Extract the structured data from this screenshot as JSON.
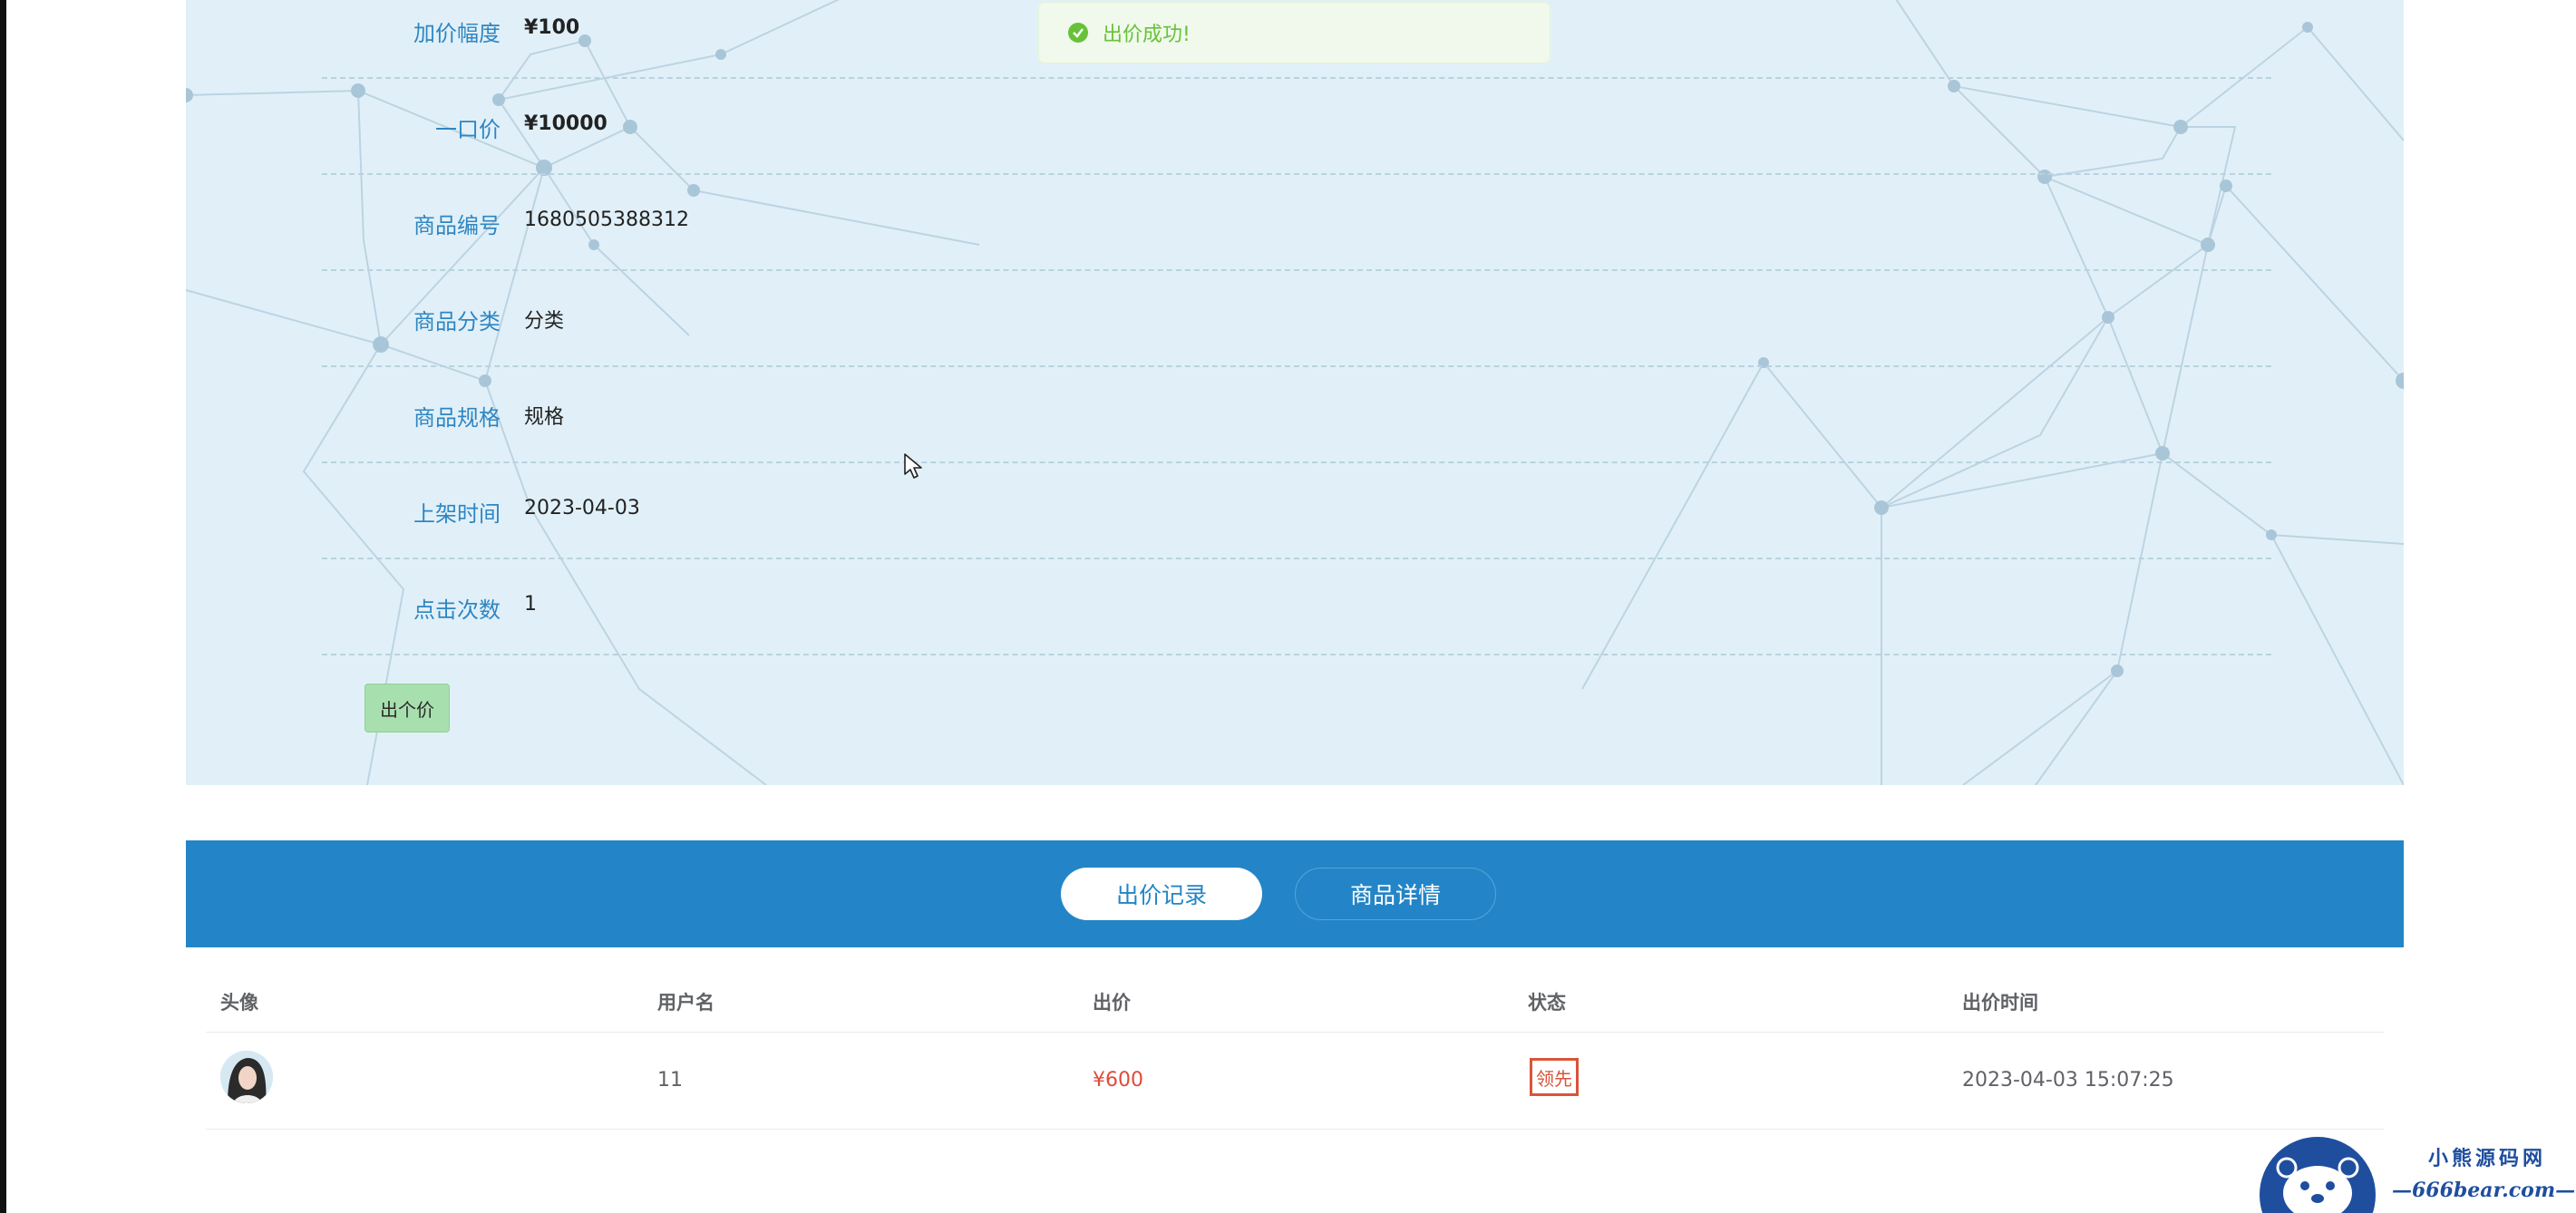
{
  "toast": {
    "message": "出价成功!",
    "icon": "check-circle-icon",
    "color": "#67c23a"
  },
  "details": [
    {
      "label": "加价幅度",
      "value": "¥100",
      "bold": true
    },
    {
      "label": "一口价",
      "value": "¥10000",
      "bold": true
    },
    {
      "label": "商品编号",
      "value": "1680505388312",
      "bold": false
    },
    {
      "label": "商品分类",
      "value": "分类",
      "bold": false
    },
    {
      "label": "商品规格",
      "value": "规格",
      "bold": false
    },
    {
      "label": "上架时间",
      "value": "2023-04-03",
      "bold": false
    },
    {
      "label": "点击次数",
      "value": "1",
      "bold": false
    }
  ],
  "bid_button_label": "出个价",
  "tabs": [
    {
      "label": "出价记录",
      "active": true
    },
    {
      "label": "商品详情",
      "active": false
    }
  ],
  "bid_table": {
    "columns": [
      "头像",
      "用户名",
      "出价",
      "状态",
      "出价时间"
    ],
    "rows": [
      {
        "username": "11",
        "price": "¥600",
        "status": "领先",
        "time": "2023-04-03 15:07:25"
      }
    ]
  },
  "watermark": {
    "name": "小熊源码网",
    "url": "—666bear.com—"
  },
  "colors": {
    "accent": "#2385c7",
    "label": "#2f86c2",
    "price": "#e04b3a",
    "status": "#d9543a",
    "panel_bg": "#e1f0f8"
  }
}
